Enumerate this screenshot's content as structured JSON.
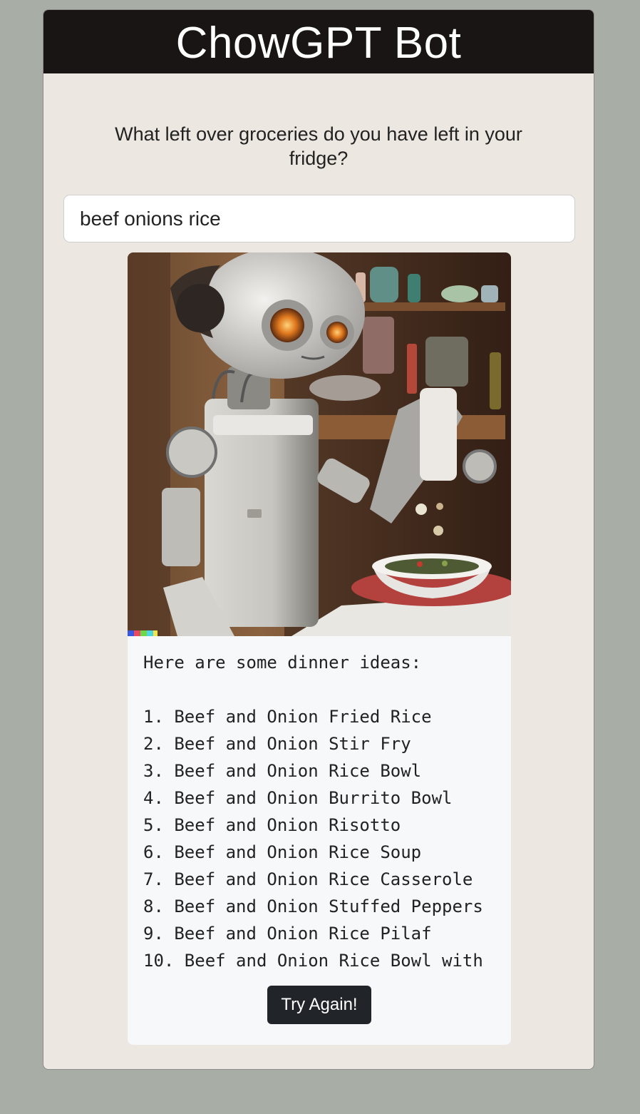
{
  "app": {
    "title": "ChowGPT Bot"
  },
  "prompt": {
    "question": "What left over groceries do you have left in your fridge?",
    "input_value": "beef onions rice"
  },
  "result": {
    "image_name": "robot-cooking-illustration",
    "intro": "Here are some dinner ideas:",
    "ideas": [
      "1. Beef and Onion Fried Rice",
      "2. Beef and Onion Stir Fry",
      "3. Beef and Onion Rice Bowl",
      "4. Beef and Onion Burrito Bowl",
      "5. Beef and Onion Risotto",
      "6. Beef and Onion Rice Soup",
      "7. Beef and Onion Rice Casserole",
      "8. Beef and Onion Stuffed Peppers",
      "9. Beef and Onion Rice Pilaf",
      "10. Beef and Onion Rice Bowl with"
    ],
    "retry_label": "Try Again!"
  },
  "colors": {
    "page_bg": "#a8ada6",
    "card_bg": "#ece7e0",
    "header_bg": "#181514",
    "button_bg": "#212529"
  }
}
